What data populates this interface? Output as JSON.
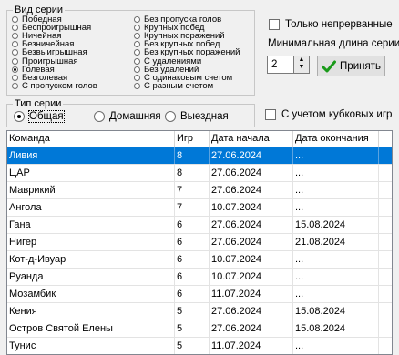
{
  "series_group": {
    "title": "Вид серии",
    "left_options": [
      {
        "label": "Победная",
        "selected": false
      },
      {
        "label": "Беспроигрышная",
        "selected": false
      },
      {
        "label": "Ничейная",
        "selected": false
      },
      {
        "label": "Безничейная",
        "selected": false
      },
      {
        "label": "Безвыигрышная",
        "selected": false
      },
      {
        "label": "Проигрышная",
        "selected": false
      },
      {
        "label": "Голевая",
        "selected": true
      },
      {
        "label": "Безголевая",
        "selected": false
      },
      {
        "label": "С пропуском голов",
        "selected": false
      }
    ],
    "right_options": [
      {
        "label": "Без пропуска голов",
        "selected": false
      },
      {
        "label": "Крупных побед",
        "selected": false
      },
      {
        "label": "Крупных поражений",
        "selected": false
      },
      {
        "label": "Без крупных побед",
        "selected": false
      },
      {
        "label": "Без крупных поражений",
        "selected": false
      },
      {
        "label": "С удалениями",
        "selected": false
      },
      {
        "label": "Без удалений",
        "selected": false
      },
      {
        "label": "С одинаковым счетом",
        "selected": false
      },
      {
        "label": "С разным счетом",
        "selected": false
      }
    ]
  },
  "continuous_only_label": "Только непрерванные",
  "min_length_label": "Минимальная длина серии",
  "min_length_value": "2",
  "accept_button_label": "Принять",
  "type_group": {
    "title": "Тип серии",
    "options": [
      {
        "label": "Общая",
        "selected": true
      },
      {
        "label": "Домашняя",
        "selected": false
      },
      {
        "label": "Выездная",
        "selected": false
      }
    ]
  },
  "cup_games_label": "С учетом кубковых игр",
  "table": {
    "columns": [
      "Команда",
      "Игр",
      "Дата начала",
      "Дата окончания"
    ],
    "rows": [
      {
        "team": "Ливия",
        "games": "8",
        "start": "27.06.2024",
        "end": "...",
        "selected": true
      },
      {
        "team": "ЦАР",
        "games": "8",
        "start": "27.06.2024",
        "end": "...",
        "selected": false
      },
      {
        "team": "Маврикий",
        "games": "7",
        "start": "27.06.2024",
        "end": "...",
        "selected": false
      },
      {
        "team": "Ангола",
        "games": "7",
        "start": "10.07.2024",
        "end": "...",
        "selected": false
      },
      {
        "team": "Гана",
        "games": "6",
        "start": "27.06.2024",
        "end": "15.08.2024",
        "selected": false
      },
      {
        "team": "Нигер",
        "games": "6",
        "start": "27.06.2024",
        "end": "21.08.2024",
        "selected": false
      },
      {
        "team": "Кот-д-Ивуар",
        "games": "6",
        "start": "10.07.2024",
        "end": "...",
        "selected": false
      },
      {
        "team": "Руанда",
        "games": "6",
        "start": "10.07.2024",
        "end": "...",
        "selected": false
      },
      {
        "team": "Мозамбик",
        "games": "6",
        "start": "11.07.2024",
        "end": "...",
        "selected": false
      },
      {
        "team": "Кения",
        "games": "5",
        "start": "27.06.2024",
        "end": "15.08.2024",
        "selected": false
      },
      {
        "team": "Остров Святой Елены",
        "games": "5",
        "start": "27.06.2024",
        "end": "15.08.2024",
        "selected": false
      },
      {
        "team": "Тунис",
        "games": "5",
        "start": "11.07.2024",
        "end": "...",
        "selected": false
      }
    ]
  }
}
